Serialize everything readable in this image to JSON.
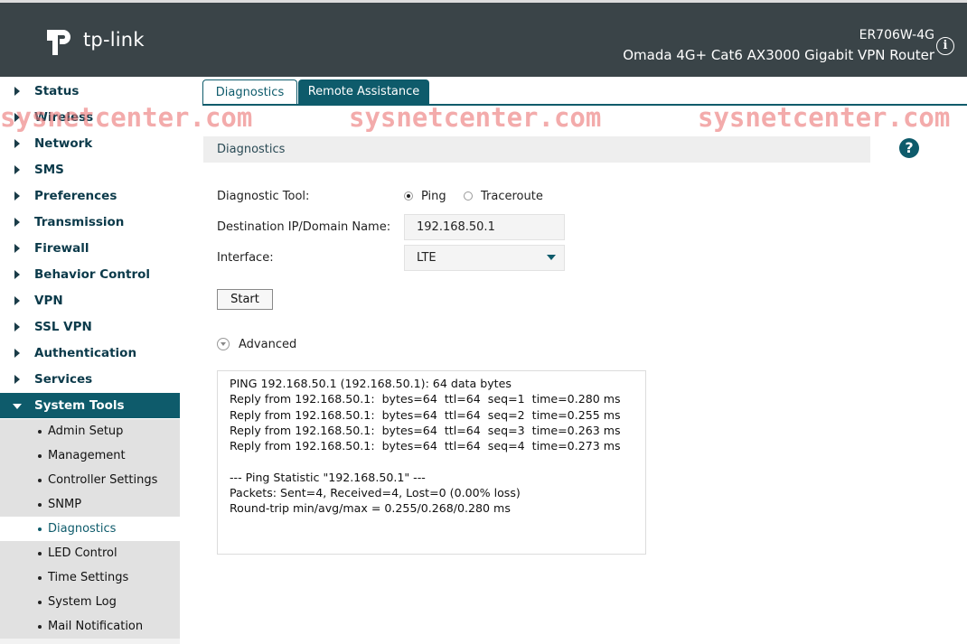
{
  "header": {
    "logo_text": "tp-link",
    "model": "ER706W-4G",
    "product": "Omada 4G+ Cat6 AX3000 Gigabit VPN Router"
  },
  "sidebar": {
    "items": [
      {
        "label": "Status"
      },
      {
        "label": "Wireless"
      },
      {
        "label": "Network"
      },
      {
        "label": "SMS"
      },
      {
        "label": "Preferences"
      },
      {
        "label": "Transmission"
      },
      {
        "label": "Firewall"
      },
      {
        "label": "Behavior Control"
      },
      {
        "label": "VPN"
      },
      {
        "label": "SSL VPN"
      },
      {
        "label": "Authentication"
      },
      {
        "label": "Services"
      },
      {
        "label": "System Tools"
      }
    ],
    "subitems": [
      {
        "label": "Admin Setup"
      },
      {
        "label": "Management"
      },
      {
        "label": "Controller Settings"
      },
      {
        "label": "SNMP"
      },
      {
        "label": "Diagnostics"
      },
      {
        "label": "LED Control"
      },
      {
        "label": "Time Settings"
      },
      {
        "label": "System Log"
      },
      {
        "label": "Mail Notification"
      }
    ]
  },
  "tabs": [
    {
      "label": "Diagnostics"
    },
    {
      "label": "Remote Assistance"
    }
  ],
  "section": {
    "title": "Diagnostics"
  },
  "form": {
    "tool_label": "Diagnostic Tool:",
    "ping_label": "Ping",
    "traceroute_label": "Traceroute",
    "dest_label": "Destination IP/Domain Name:",
    "dest_value": "192.168.50.1",
    "iface_label": "Interface:",
    "iface_value": "LTE",
    "start_label": "Start",
    "advanced_label": "Advanced"
  },
  "output": {
    "lines": [
      "PING 192.168.50.1 (192.168.50.1): 64 data bytes",
      "Reply from 192.168.50.1:  bytes=64  ttl=64  seq=1  time=0.280 ms",
      "Reply from 192.168.50.1:  bytes=64  ttl=64  seq=2  time=0.255 ms",
      "Reply from 192.168.50.1:  bytes=64  ttl=64  seq=3  time=0.263 ms",
      "Reply from 192.168.50.1:  bytes=64  ttl=64  seq=4  time=0.273 ms",
      "",
      "--- Ping Statistic \"192.168.50.1\" ---",
      "Packets: Sent=4, Received=4, Lost=0 (0.00% loss)",
      "Round-trip min/avg/max = 0.255/0.268/0.280 ms"
    ]
  },
  "watermark": "sysnetcenter.com"
}
